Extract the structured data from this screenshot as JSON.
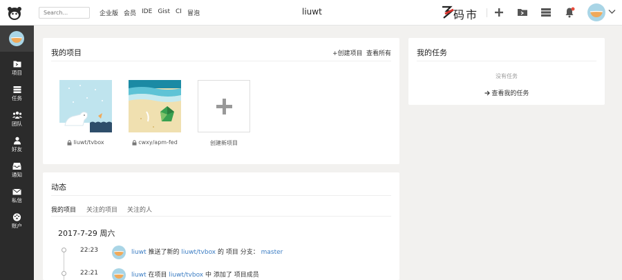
{
  "topbar": {
    "search_placeholder": "Search...",
    "nav": [
      "企业版",
      "会员",
      "IDE",
      "Gist",
      "CI",
      "冒泡"
    ],
    "user_title": "liuwt",
    "brand_text": "码市",
    "icons": [
      "plus-icon",
      "folder-icon",
      "server-icon",
      "bell-icon"
    ],
    "notification_dot_color": "#e74c3c"
  },
  "sidebar": {
    "items": [
      {
        "label": "项目",
        "icon": "project-icon"
      },
      {
        "label": "任务",
        "icon": "task-icon"
      },
      {
        "label": "团队",
        "icon": "team-icon"
      },
      {
        "label": "好友",
        "icon": "friend-icon"
      },
      {
        "label": "通知",
        "icon": "inbox-icon"
      },
      {
        "label": "私信",
        "icon": "mail-icon"
      },
      {
        "label": "账户",
        "icon": "palette-icon"
      }
    ]
  },
  "projects_card": {
    "title": "我的项目",
    "create_link": "+创建项目",
    "view_all_link": "查看所有",
    "projects": [
      {
        "name": "liuwt/tvbox",
        "private": true
      },
      {
        "name": "cwxy/apm-fed",
        "private": true
      }
    ],
    "new_project_label": "创建新项目"
  },
  "tasks_card": {
    "title": "我的任务",
    "empty_text": "没有任务",
    "view_link": "查看我的任务"
  },
  "activity_card": {
    "title": "动态",
    "tabs": [
      "我的项目",
      "关注的项目",
      "关注的人"
    ],
    "date": "2017-7-29 周六",
    "events": [
      {
        "time": "22:23",
        "user": "liuwt",
        "action": "推送了新的",
        "project": "liuwt/tvbox",
        "tail": "的 项目 分支：",
        "branch": "master"
      },
      {
        "time": "22:21",
        "user": "liuwt",
        "action": "在项目",
        "project": "liuwt/tvbox",
        "tail": "中 添加了 项目成员",
        "branch": ""
      }
    ]
  },
  "colors": {
    "sidebar_bg": "#2b2b2b",
    "link": "#3a7cc3",
    "page_bg": "#f2f1ef"
  }
}
